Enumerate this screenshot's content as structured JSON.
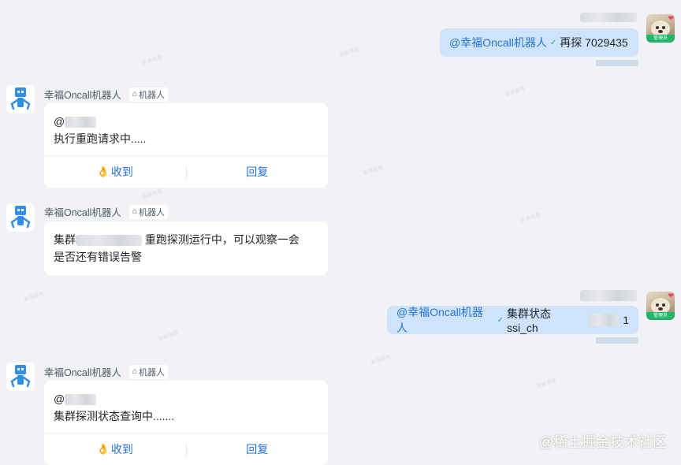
{
  "bot": {
    "name": "幸福Oncall机器人",
    "tag_label": "机器人",
    "tag_icon": "robot-icon"
  },
  "outgoing_messages": [
    {
      "mention": "@幸福Oncall机器人",
      "text": "再探 7029435",
      "avatar_badge": "管理员"
    },
    {
      "mention": "@幸福Oncall机器人",
      "text": "集群状态 ssi_ch",
      "text_tail": "1",
      "avatar_badge": "管理员"
    }
  ],
  "bot_messages": [
    {
      "mention": "@",
      "lines": [
        "执行重跑请求中....."
      ],
      "actions": {
        "ack": "收到",
        "reply": "回复"
      }
    },
    {
      "line1_prefix": "集群",
      "line1_suffix": "重跑探测运行中，可以观察一会",
      "line2": "是否还有错误告警"
    },
    {
      "mention": "@",
      "lines": [
        "集群探测状态查询中......."
      ],
      "actions": {
        "ack": "收到",
        "reply": "回复"
      }
    }
  ],
  "footer": {
    "watermark_text": "@稀土掘金技术社区"
  },
  "colors": {
    "background": "#f1f2f5",
    "outgoing_bubble": "#cfe4fc",
    "mention": "#2473d6",
    "action": "#2473d6",
    "verified": "#1fb56a"
  }
}
